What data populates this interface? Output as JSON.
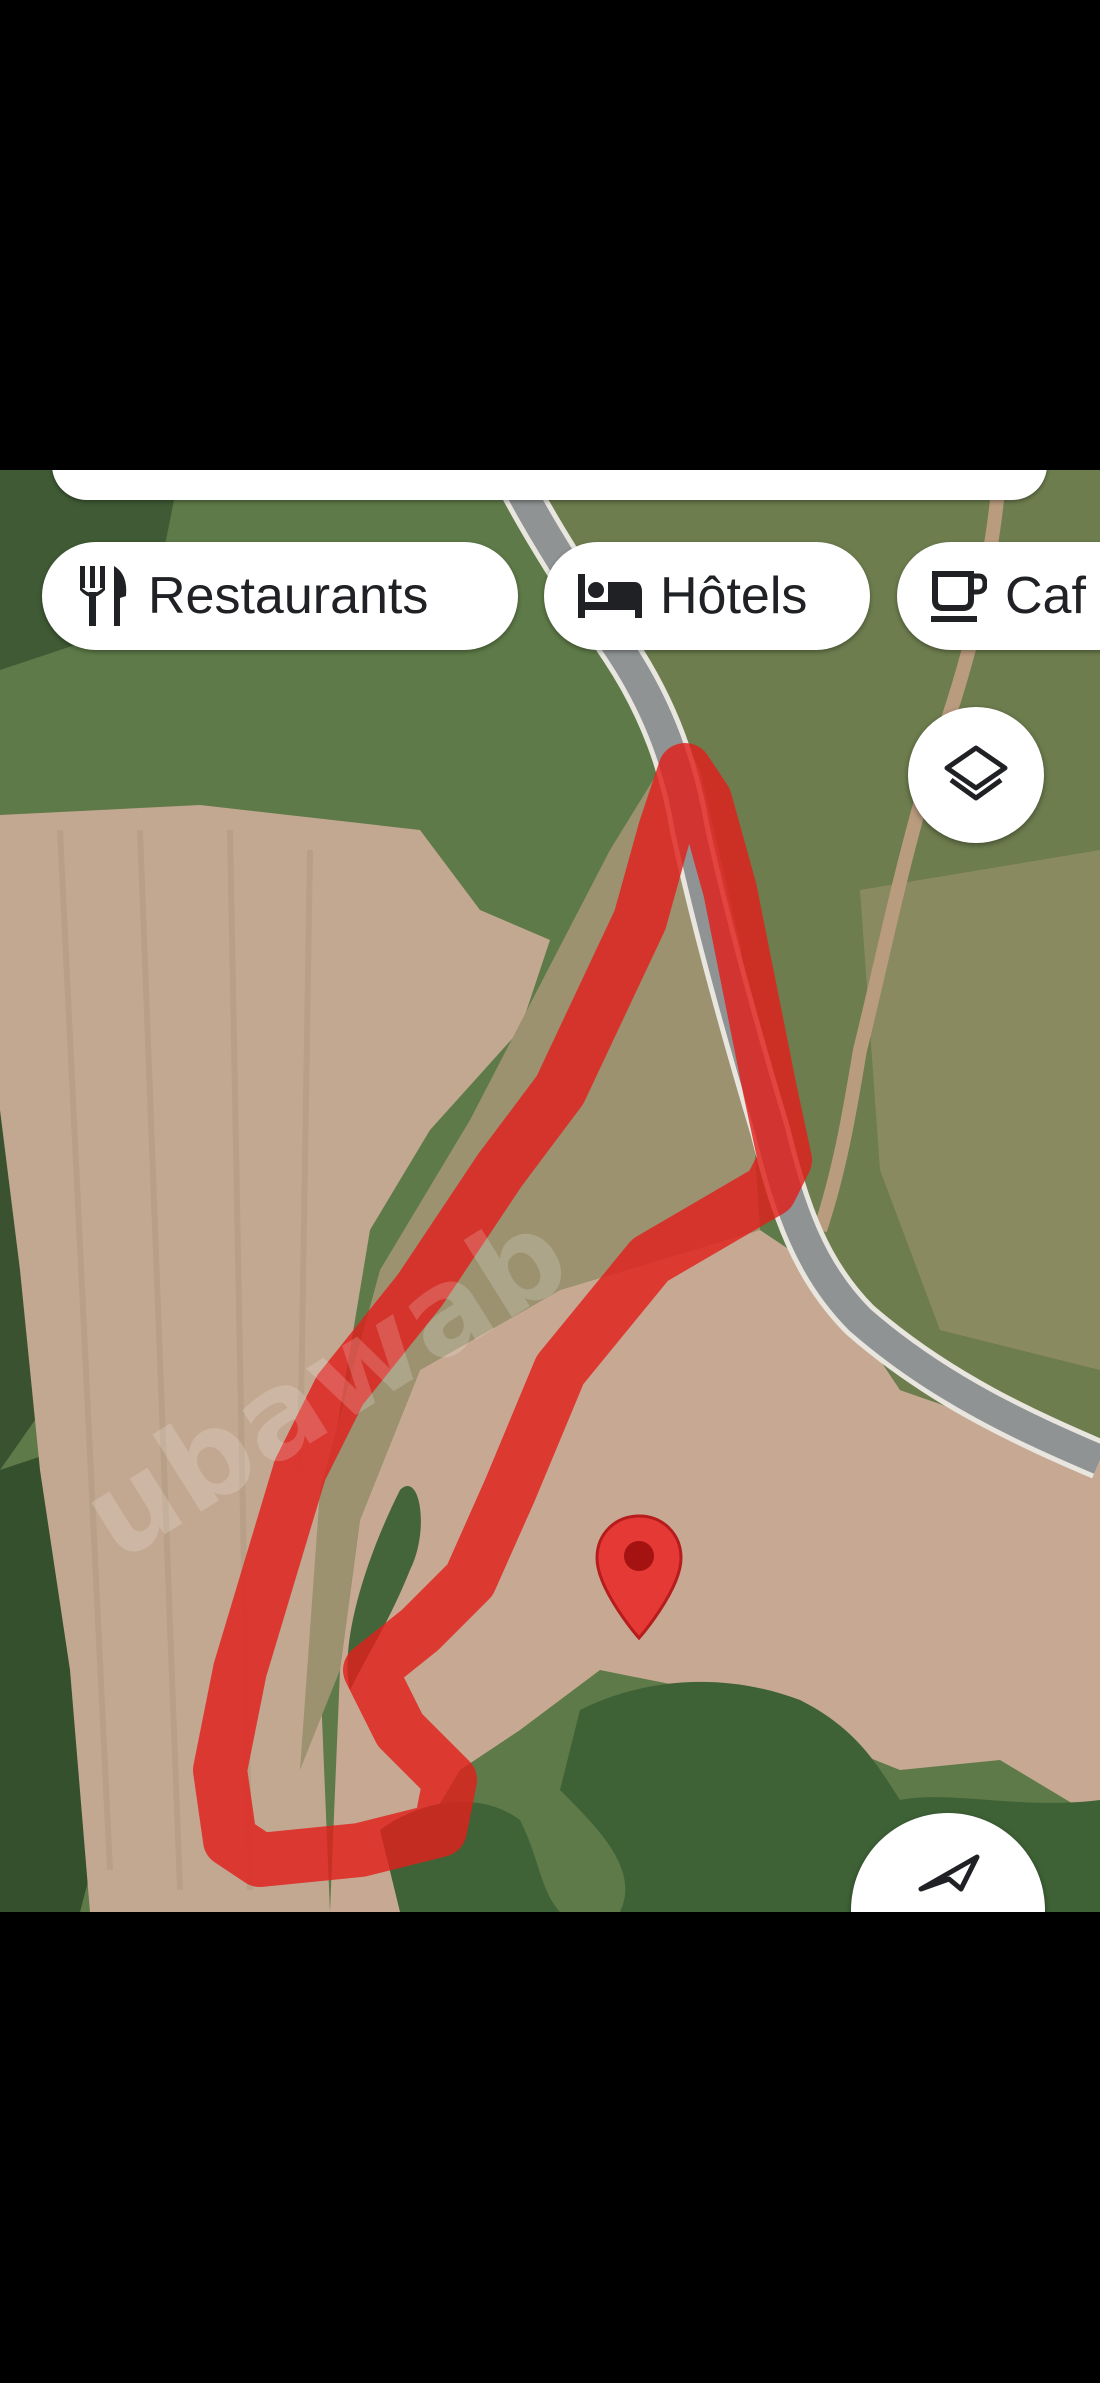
{
  "search_chips": [
    {
      "label": "Restaurants",
      "icon": "restaurant-icon"
    },
    {
      "label": "Hôtels",
      "icon": "hotel-icon"
    },
    {
      "label": "Caf",
      "icon": "cafe-icon"
    }
  ],
  "controls": {
    "layers": {
      "icon": "layers-icon"
    },
    "navigate": {
      "icon": "navigation-arrow-icon"
    }
  },
  "map": {
    "type": "satellite",
    "marker_icon": "map-pin-icon",
    "marker_color": "#e53935",
    "route_color": "#e0201c",
    "watermark": "ubawab"
  }
}
